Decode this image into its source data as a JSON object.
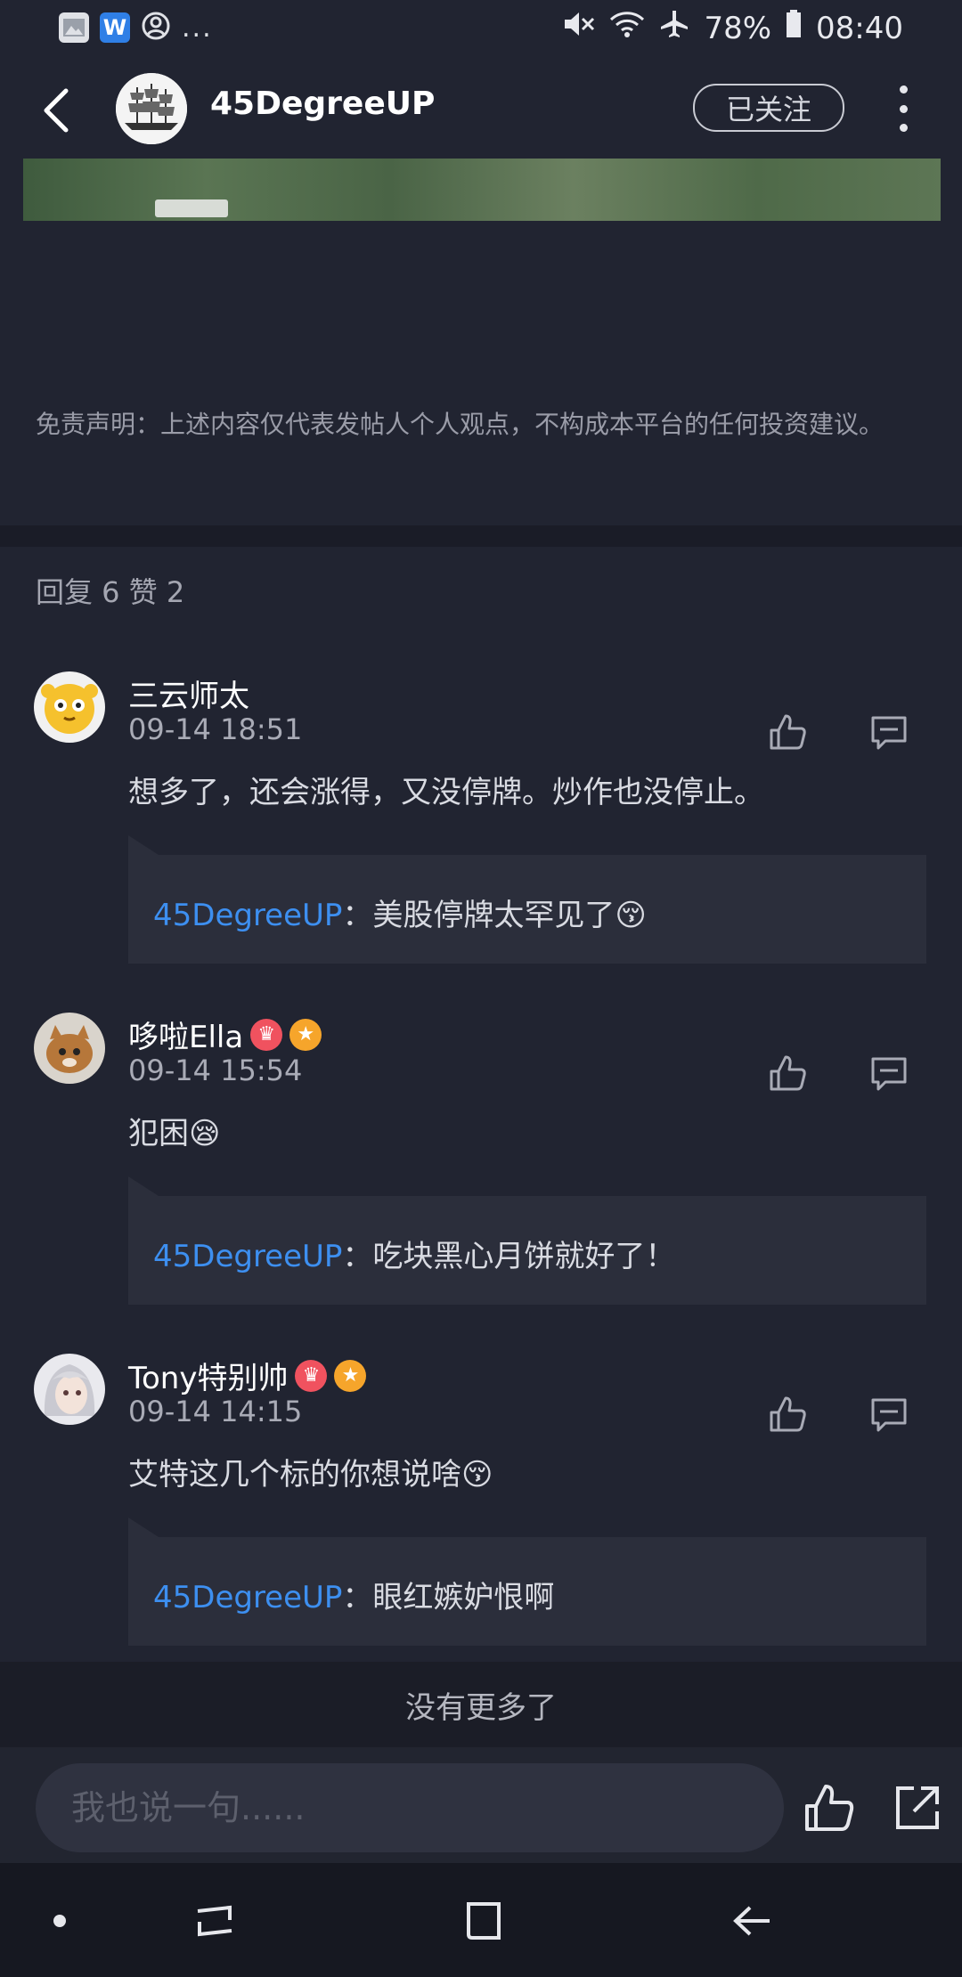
{
  "status_bar": {
    "dots": "...",
    "battery": "78%",
    "time": "08:40"
  },
  "header": {
    "title": "45DegreeUP",
    "follow_label": "已关注"
  },
  "post": {
    "disclaimer": "免责声明：上述内容仅代表发帖人个人观点，不构成本平台的任何投资建议。"
  },
  "stats": {
    "text": "回复 6  赞 2"
  },
  "comments": [
    {
      "name": "三云师太",
      "time": "09-14 18:51",
      "text": "想多了，还会涨得，又没停牌。炒作也没停止。",
      "badges": [],
      "reply": {
        "author": "45DegreeUP",
        "text": "：美股停牌太罕见了😚"
      }
    },
    {
      "name": "哆啦Ella",
      "time": "09-14 15:54",
      "text": "犯困😪",
      "badges": [
        "crown",
        "star"
      ],
      "reply": {
        "author": "45DegreeUP",
        "text": "：吃块黑心月饼就好了！"
      }
    },
    {
      "name": "Tony特别帅",
      "time": "09-14 14:15",
      "text": "艾特这几个标的你想说啥😚",
      "badges": [
        "crown",
        "star"
      ],
      "reply": {
        "author": "45DegreeUP",
        "text": "：眼红嫉妒恨啊"
      }
    }
  ],
  "footer": {
    "no_more": "没有更多了",
    "input_placeholder": "我也说一句......"
  },
  "colors": {
    "background": "#212431",
    "reply_background": "#2b2e3b",
    "accent_blue": "#3d8ff0",
    "badge_crown": "#f0525f",
    "badge_star": "#f6a52b"
  }
}
